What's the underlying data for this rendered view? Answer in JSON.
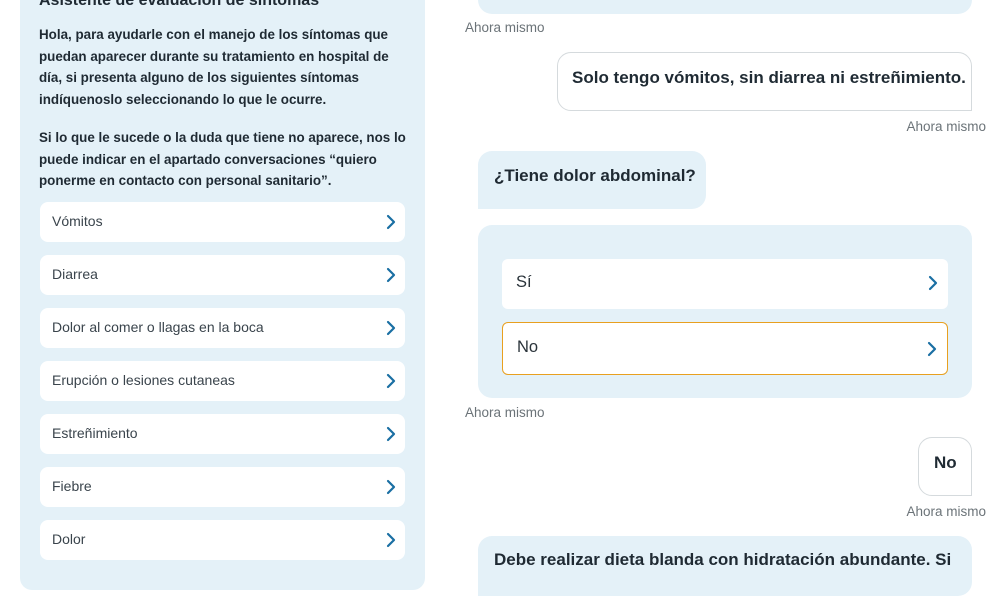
{
  "symptom_panel": {
    "title": "Asistente de evaluación de síntomas",
    "intro_1": "Hola, para ayudarle con el manejo de los síntomas que puedan aparecer durante su tratamiento en hospital de día, si presenta alguno de los siguientes síntomas indíquenoslo seleccionando lo que le ocurre.",
    "intro_2": "Si lo que le sucede o la duda que tiene no aparece, nos lo puede indicar en el apartado conversaciones “quiero ponerme en contacto con personal sanitario”.",
    "items": [
      {
        "label": "Vómitos"
      },
      {
        "label": "Diarrea"
      },
      {
        "label": "Dolor al comer o llagas en la boca"
      },
      {
        "label": "Erupción o lesiones cutaneas"
      },
      {
        "label": "Estreñimiento"
      },
      {
        "label": "Fiebre"
      },
      {
        "label": "Dolor"
      }
    ]
  },
  "chat": {
    "ts_1": "Ahora mismo",
    "user_msg_1": "Solo tengo vómitos, sin diarrea ni estreñimiento.",
    "ts_2": "Ahora mismo",
    "bot_question": "¿Tiene dolor abdominal?",
    "options": [
      {
        "label": "Sí",
        "selected": false
      },
      {
        "label": "No",
        "selected": true
      }
    ],
    "ts_3": "Ahora mismo",
    "user_msg_2": "No",
    "ts_4": "Ahora mismo",
    "bot_answer": "Debe realizar dieta blanda con hidratación abundante. Si"
  },
  "colors": {
    "panel_bg": "#e4f1f8",
    "chevron": "#1a6fa3",
    "selected_border": "#e8a020"
  },
  "icons": {
    "chevron": "chevron-right-icon"
  }
}
